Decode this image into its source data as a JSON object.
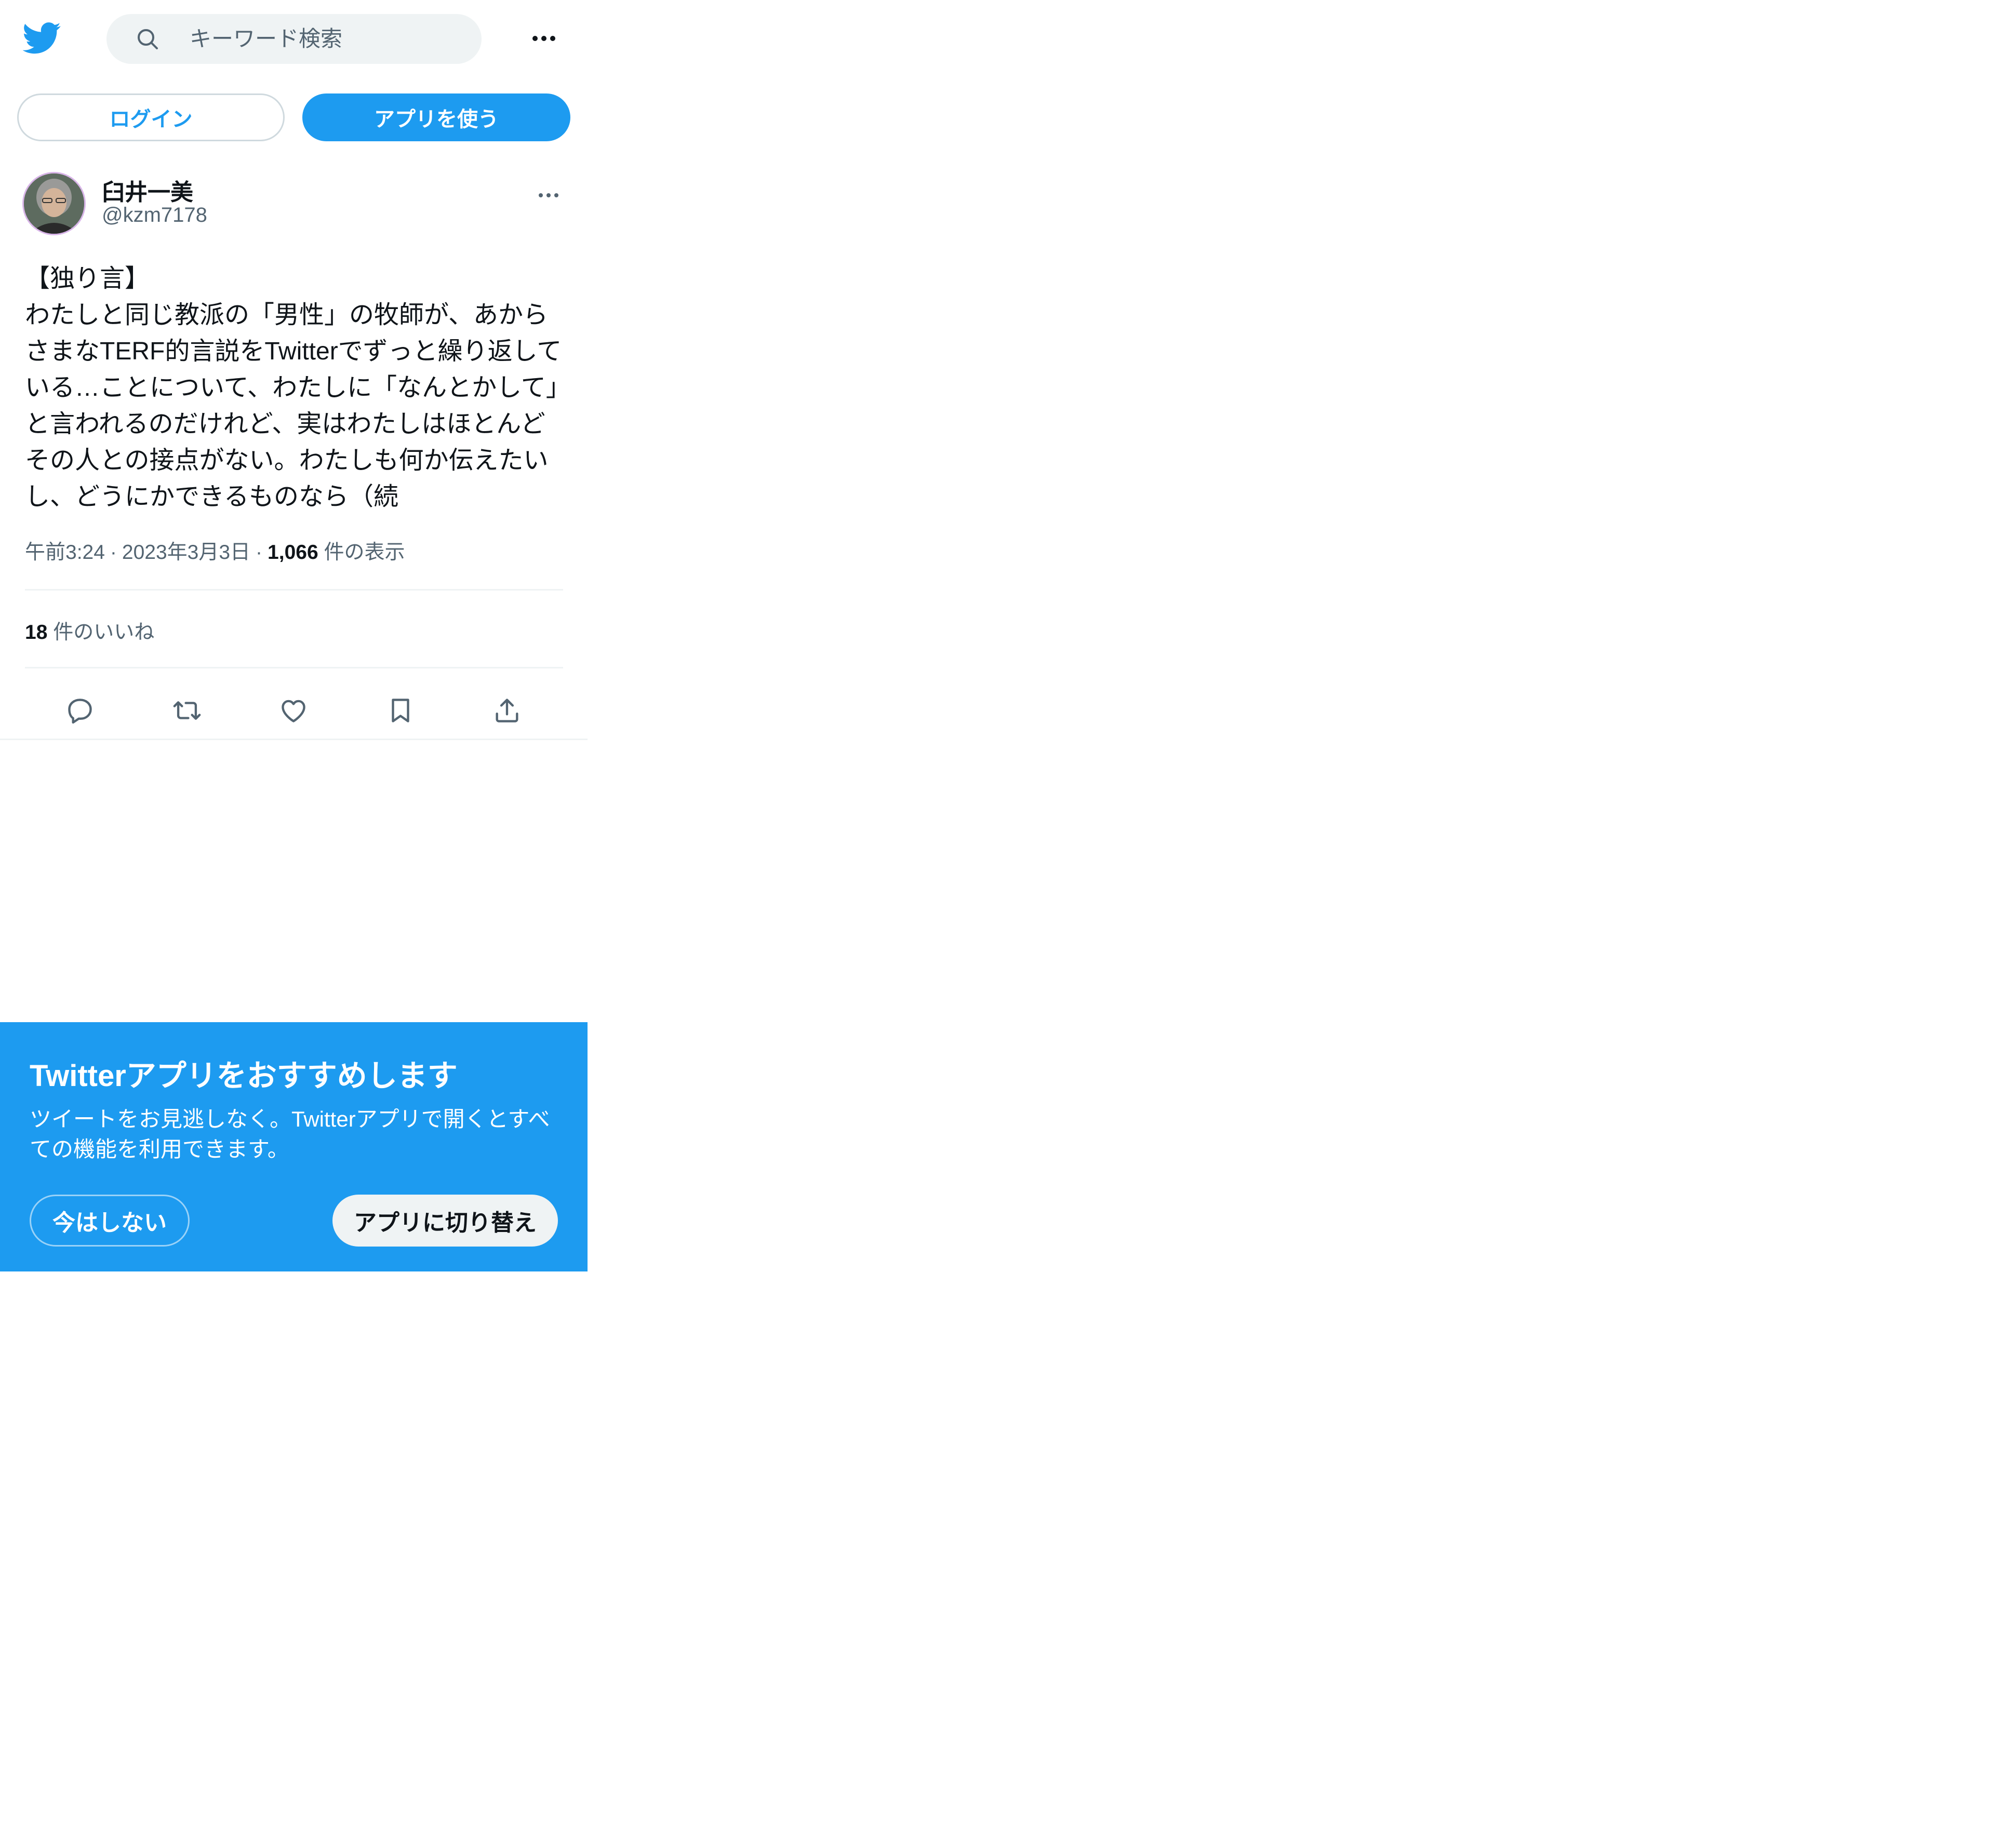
{
  "header": {
    "search_placeholder": "キーワード検索"
  },
  "auth": {
    "login_label": "ログイン",
    "use_app_label": "アプリを使う"
  },
  "tweet": {
    "display_name": "臼井一美",
    "handle": "@kzm7178",
    "text": "【独り言】\nわたしと同じ教派の「男性」の牧師が、あからさまなTERF的言説をTwitterでずっと繰り返している…ことについて、わたしに「なんとかして」と言われるのだけれど、実はわたしはほとんどその人との接点がない。わたしも何か伝えたいし、どうにかできるものなら（続",
    "time": "午前3:24",
    "date": "2023年3月3日",
    "views_count": "1,066",
    "views_label": "件の表示",
    "likes_count": "18",
    "likes_label": "件のいいね"
  },
  "banner": {
    "title": "Twitterアプリをおすすめします",
    "text": "ツイートをお見逃しなく。Twitterアプリで開くとすべての機能を利用できます。",
    "not_now_label": "今はしない",
    "switch_label": "アプリに切り替え"
  },
  "colors": {
    "brand": "#1d9bf0",
    "text": "#0f1419",
    "secondary": "#536471",
    "divider": "#eff3f4"
  },
  "icons": [
    "twitter-logo-icon",
    "search-icon",
    "more-icon",
    "reply-icon",
    "retweet-icon",
    "like-icon",
    "bookmark-icon",
    "share-icon"
  ]
}
